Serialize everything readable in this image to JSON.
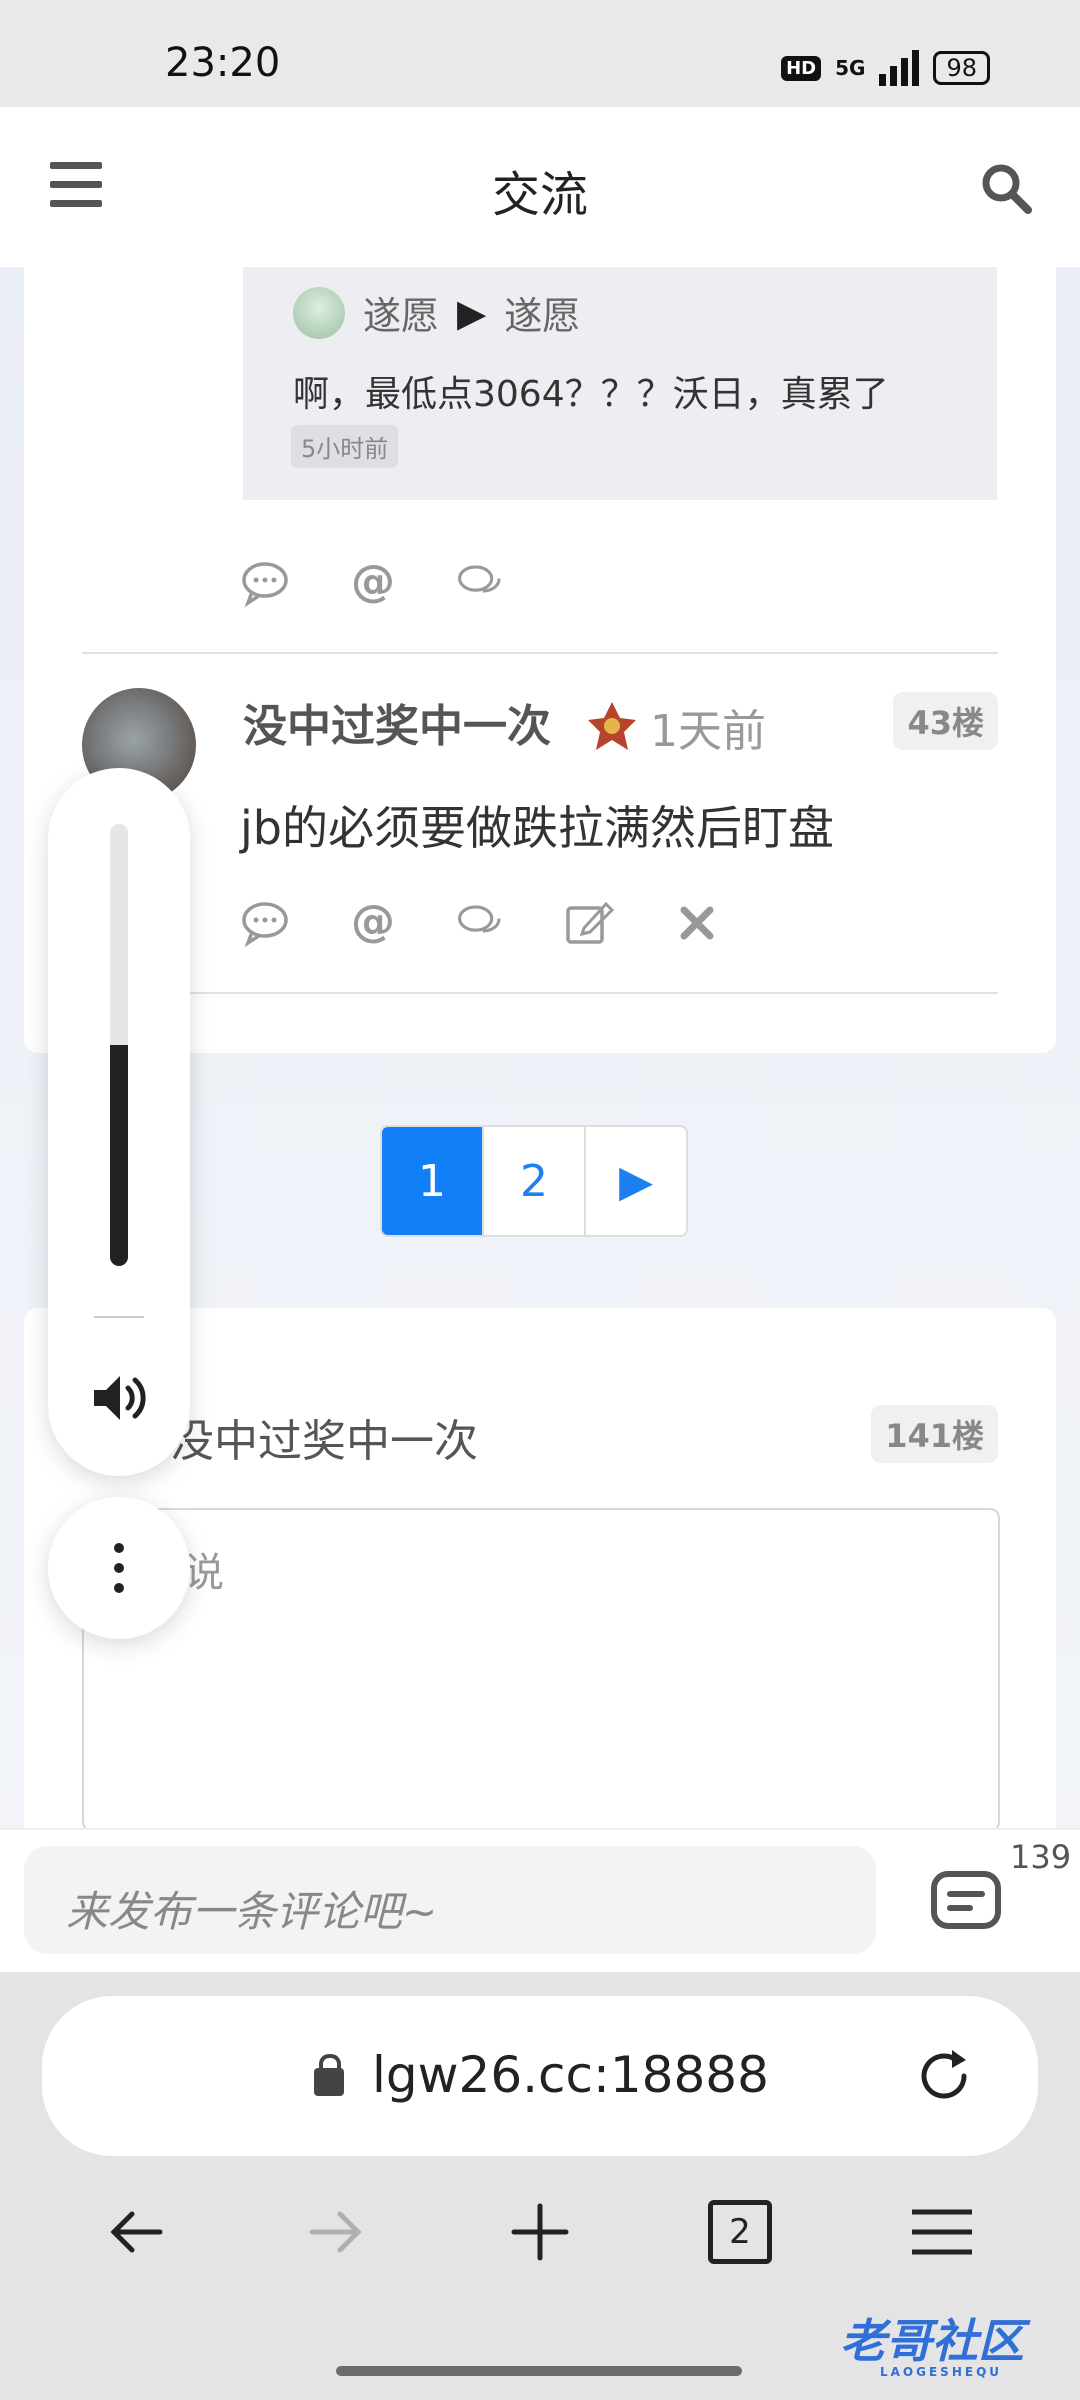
{
  "status": {
    "time": "23:20",
    "hd": "HD",
    "net": "5G",
    "battery": "98"
  },
  "header": {
    "title": "交流"
  },
  "quote": {
    "from": "遂愿",
    "arrow": "▶",
    "to": "遂愿",
    "text": "啊，最低点3064？？？沃日，真累了",
    "time": "5小时前"
  },
  "post": {
    "username": "没中过奖中一次",
    "time": "1天前",
    "floor": "43楼",
    "content": "jb的必须要做跌拉满然后盯盘"
  },
  "pager": {
    "pages": [
      "1",
      "2"
    ],
    "next": "▶",
    "active": "1"
  },
  "reply": {
    "username": "没中过奖中一次",
    "floor": "141楼",
    "placeholder": "说"
  },
  "comment_bar": {
    "placeholder": "来发布一条评论吧~",
    "count": "139"
  },
  "browser": {
    "url": "lgw26.cc:18888",
    "tabs": "2"
  },
  "watermark": {
    "text": "老哥社区",
    "sub": "LAOGESHEQU"
  },
  "volume": {
    "level": 0.5
  }
}
